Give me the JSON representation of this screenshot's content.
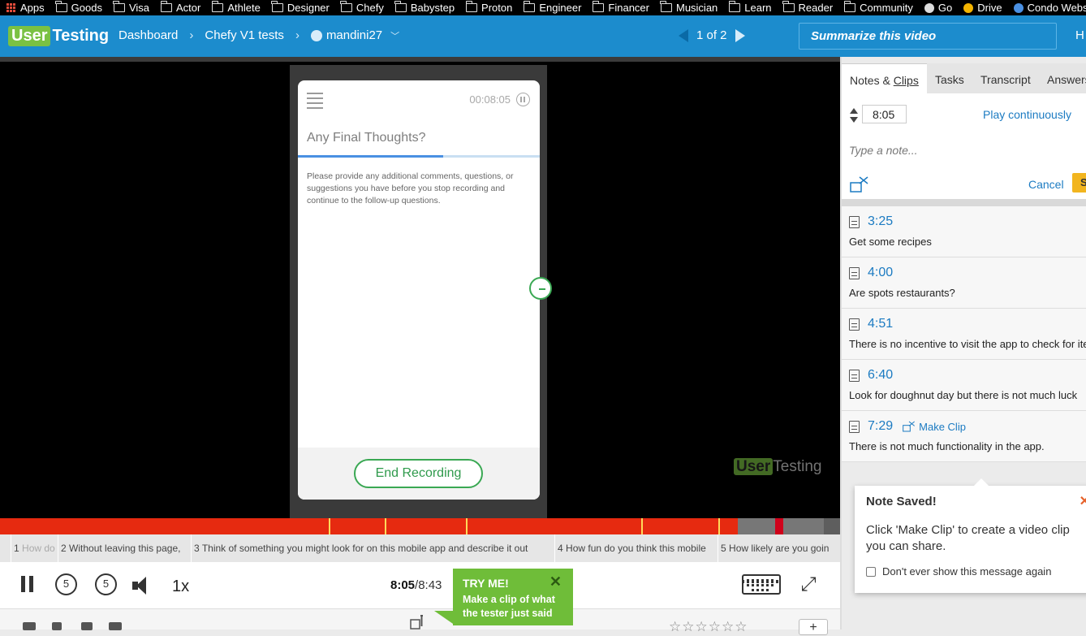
{
  "bookmarks": [
    "Apps",
    "Goods",
    "Visa",
    "Actor",
    "Athlete",
    "Designer",
    "Chefy",
    "Babystep",
    "Proton",
    "Engineer",
    "Financer",
    "Musician",
    "Learn",
    "Reader",
    "Community",
    "Go",
    "Drive",
    "Condo Webs"
  ],
  "header": {
    "logo_user": "User",
    "logo_testing": "Testing",
    "crumbs": [
      "Dashboard",
      "Chefy V1 tests",
      "mandini27"
    ],
    "pager": "1 of 2",
    "summarize_placeholder": "Summarize this video",
    "trailing": "H"
  },
  "phone": {
    "timer": "00:08:05",
    "question": "Any Final Thoughts?",
    "body": "Please provide any additional comments, questions, or suggestions you have before you stop recording and continue to the follow-up questions.",
    "end_button": "End Recording",
    "progress": 0.6
  },
  "watermark": {
    "user": "User",
    "testing": "Testing"
  },
  "timeline": {
    "played_fraction": 0.955,
    "task_markers_fraction": [
      0.391,
      0.458,
      0.555,
      0.763,
      0.855
    ]
  },
  "tasks": [
    {
      "num": "1",
      "text": "How do"
    },
    {
      "num": "2",
      "text": "Without leaving this page,"
    },
    {
      "num": "3",
      "text": "Think of something you might look for on this mobile app and describe it out"
    },
    {
      "num": "4",
      "text": "How fun do you think this mobile"
    },
    {
      "num": "5",
      "text": "How likely are you goin"
    }
  ],
  "player": {
    "skip_back": "5",
    "skip_fwd": "5",
    "speed": "1x",
    "current_time": "8:05",
    "duration": "/8:43"
  },
  "tryme": {
    "title": "TRY ME!",
    "body": "Make a clip of what the tester just said",
    "close": "✕"
  },
  "panel": {
    "tabs": [
      {
        "pre": "Notes & ",
        "u": "Clips"
      },
      {
        "pre": "Tasks",
        "u": ""
      },
      {
        "pre": "Transcript",
        "u": ""
      },
      {
        "pre": "Answers",
        "u": ""
      }
    ],
    "time_value": "8:05",
    "play_continuously": "Play continuously",
    "note_placeholder": "Type a note...",
    "cancel": "Cancel",
    "save_stub": "S"
  },
  "notes": [
    {
      "time": "3:25",
      "text": "Get some recipes",
      "make_clip": ""
    },
    {
      "time": "4:00",
      "text": "Are spots restaurants?",
      "make_clip": ""
    },
    {
      "time": "4:51",
      "text": "There is no incentive to visit the app to check for item",
      "make_clip": ""
    },
    {
      "time": "6:40",
      "text": "Look for doughnut day but there is not much luck",
      "make_clip": ""
    },
    {
      "time": "7:29",
      "text": "There is not much functionality in the app.",
      "make_clip": "Make Clip"
    }
  ],
  "popup": {
    "title": "Note Saved!",
    "body": "Click 'Make Clip' to create a video clip you can share.",
    "checkbox": "Don't ever show this message again",
    "close": "✕"
  },
  "bottom": {
    "stars": "☆☆☆☆☆☆",
    "plus": "+"
  },
  "colors": {
    "brand_blue": "#1c8ccd",
    "brand_green": "#7ac143",
    "timeline_red": "#e62a10",
    "link_blue": "#1c7bc2"
  }
}
